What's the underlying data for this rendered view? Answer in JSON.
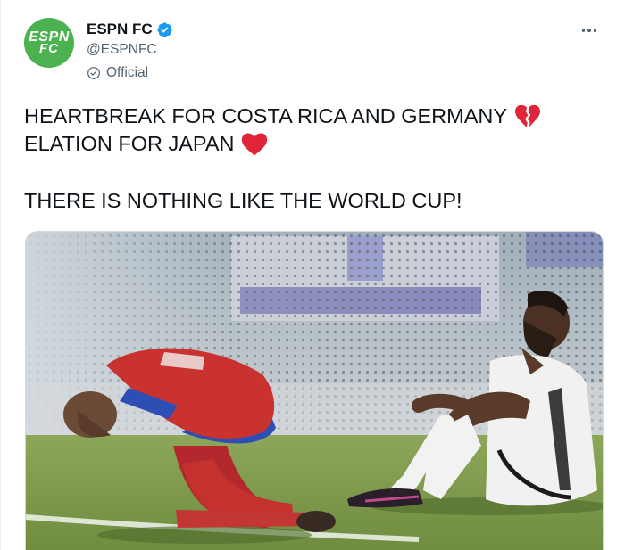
{
  "account": {
    "display_name": "ESPN FC",
    "handle": "@ESPNFC",
    "label": "Official",
    "avatar_text_line1": "ESPN",
    "avatar_text_line2": "FC"
  },
  "tweet": {
    "line1": "HEARTBREAK FOR COSTA RICA AND GERMANY",
    "line2": "ELATION FOR JAPAN",
    "line3": "THERE IS NOTHING LIKE THE WORLD CUP!"
  },
  "icons": {
    "verified": "verified-badge-icon",
    "official": "official-check-icon",
    "broken_heart": "broken-heart-icon",
    "heart": "red-heart-icon",
    "more": "more-options-icon"
  },
  "colors": {
    "brand_green": "#4bb24f",
    "verified_blue": "#1d9bf0",
    "heart_red": "#e0243a",
    "secondary_text": "#536471"
  }
}
